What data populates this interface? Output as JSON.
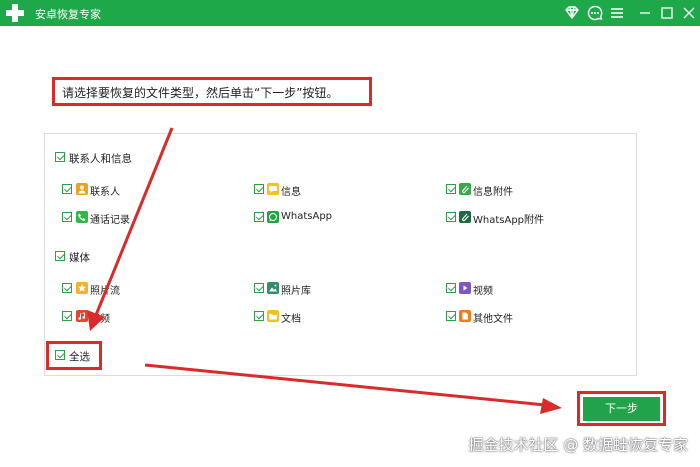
{
  "app": {
    "title": "安卓恢复专家"
  },
  "instruction": "请选择要恢复的文件类型，然后单击“下一步”按钮。",
  "groups": [
    {
      "label": "联系人和信息",
      "items": [
        {
          "label": "联系人",
          "icon": "contacts-icon",
          "color": "#f0a020"
        },
        {
          "label": "信息",
          "icon": "messages-icon",
          "color": "#f3c21b"
        },
        {
          "label": "信息附件",
          "icon": "message-attachment-icon",
          "color": "#36a94b"
        },
        {
          "label": "通话记录",
          "icon": "call-log-icon",
          "color": "#32b549"
        },
        {
          "label": "WhatsApp",
          "icon": "whatsapp-icon",
          "color": "#26a344"
        },
        {
          "label": "WhatsApp附件",
          "icon": "whatsapp-attachment-icon",
          "color": "#1e6b43"
        }
      ]
    },
    {
      "label": "媒体",
      "items": [
        {
          "label": "照片流",
          "icon": "photo-stream-icon",
          "color": "#f5b324"
        },
        {
          "label": "照片库",
          "icon": "photo-library-icon",
          "color": "#2f8f6b"
        },
        {
          "label": "视频",
          "icon": "video-icon",
          "color": "#7e57c2"
        },
        {
          "label": "音频",
          "icon": "audio-icon",
          "color": "#e8432e"
        },
        {
          "label": "文档",
          "icon": "documents-icon",
          "color": "#f3c21b"
        },
        {
          "label": "其他文件",
          "icon": "other-files-icon",
          "color": "#f07d1a"
        }
      ]
    }
  ],
  "select_all": "全选",
  "next_button": "下一步",
  "watermark": "掘金技术社区 @ 数据蛙恢复专家",
  "colors": {
    "brand": "#1fa84a",
    "highlight": "#d92b2b",
    "button": "#21a34b"
  }
}
